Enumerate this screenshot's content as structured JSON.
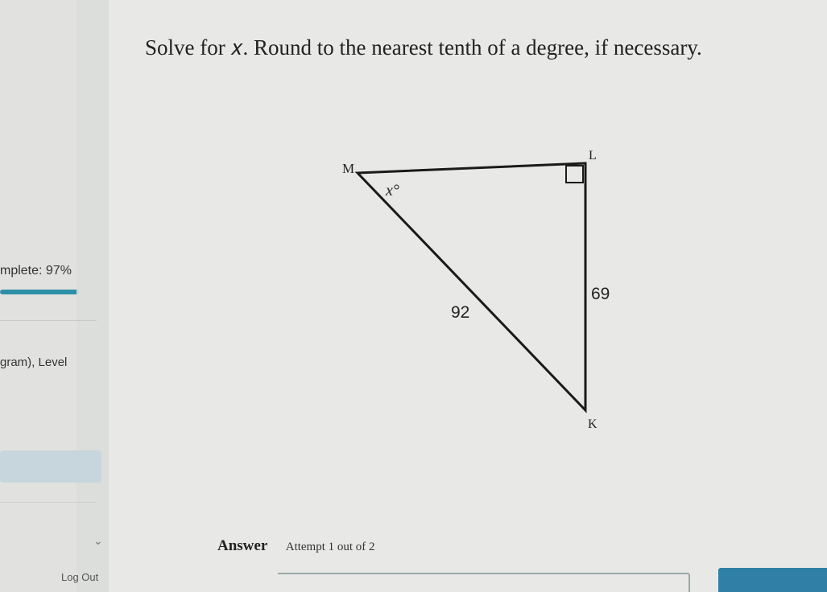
{
  "sidebar": {
    "progress_label": "mplete: 97%",
    "progress_value": 0.97,
    "program_label": "gram), Level",
    "logout_label": "Log Out"
  },
  "question": {
    "text": "Solve for 𝑥. Round to the nearest tenth of a degree, if necessary."
  },
  "figure": {
    "vertex_m": "M",
    "vertex_l": "L",
    "vertex_k": "K",
    "angle_label": "x°",
    "hypotenuse_label": "92",
    "side_lk_label": "69",
    "right_angle_at": "L"
  },
  "answer": {
    "title": "Answer",
    "attempt_text": "Attempt 1 out of 2",
    "value": ""
  },
  "colors": {
    "accent": "#2f7fa6",
    "progress": "#2e8fa8"
  }
}
